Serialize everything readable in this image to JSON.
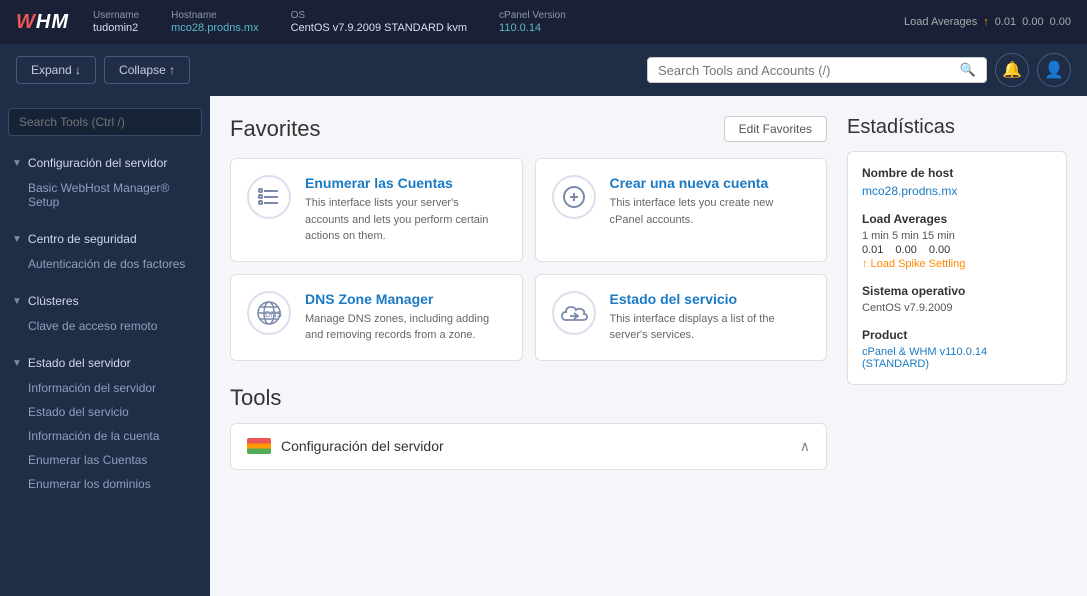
{
  "topbar": {
    "logo": "WHM",
    "meta": {
      "username_label": "Username",
      "username_value": "tudomin2",
      "hostname_label": "Hostname",
      "hostname_value": "mco28.prodns.mx",
      "os_label": "OS",
      "os_value": "CentOS v7.9.2009 STANDARD kvm",
      "cpanel_label": "cPanel Version",
      "cpanel_value": "110.0.14",
      "load_label": "Load Averages",
      "load_1": "0.01",
      "load_5": "0.00",
      "load_15": "0.00"
    }
  },
  "toolbar": {
    "expand_label": "Expand ↓",
    "collapse_label": "Collapse ↑",
    "search_placeholder": "Search Tools and Accounts (/)"
  },
  "sidebar": {
    "search_placeholder": "Search Tools (Ctrl /)",
    "sections": [
      {
        "label": "Configuración del servidor",
        "items": [
          "Basic WebHost Manager® Setup"
        ]
      },
      {
        "label": "Centro de seguridad",
        "items": [
          "Autenticación de dos factores"
        ]
      },
      {
        "label": "Clústeres",
        "items": [
          "Clave de acceso remoto"
        ]
      },
      {
        "label": "Estado del servidor",
        "items": [
          "Información del servidor",
          "Estado del servicio",
          "Información de la cuenta",
          "Enumerar las Cuentas",
          "Enumerar los dominios"
        ]
      }
    ]
  },
  "favorites": {
    "title": "Favorites",
    "edit_button": "Edit Favorites",
    "cards": [
      {
        "title": "Enumerar las Cuentas",
        "desc": "This interface lists your server's accounts and lets you perform certain actions on them.",
        "icon": "list"
      },
      {
        "title": "Crear una nueva cuenta",
        "desc": "This interface lets you create new cPanel accounts.",
        "icon": "plus-circle"
      },
      {
        "title": "DNS Zone Manager",
        "desc": "Manage DNS zones, including adding and removing records from a zone.",
        "icon": "dns"
      },
      {
        "title": "Estado del servicio",
        "desc": "This interface displays a list of the server's services.",
        "icon": "cloud"
      }
    ]
  },
  "tools": {
    "title": "Tools",
    "section_label": "Configuración del servidor"
  },
  "stats": {
    "title": "Estadísticas",
    "groups": [
      {
        "label": "Nombre de host",
        "value": "mco28.prodns.mx"
      },
      {
        "label": "Load Averages",
        "sub_labels": "1 min  5 min  15 min",
        "nums": [
          "0.01",
          "0.00",
          "0.00"
        ],
        "spike": "↑ Load Spike Settling"
      },
      {
        "label": "Sistema operativo",
        "value": "CentOS v7.9.2009"
      },
      {
        "label": "Product",
        "value": "cPanel & WHM v110.0.14 (STANDARD)"
      }
    ]
  }
}
